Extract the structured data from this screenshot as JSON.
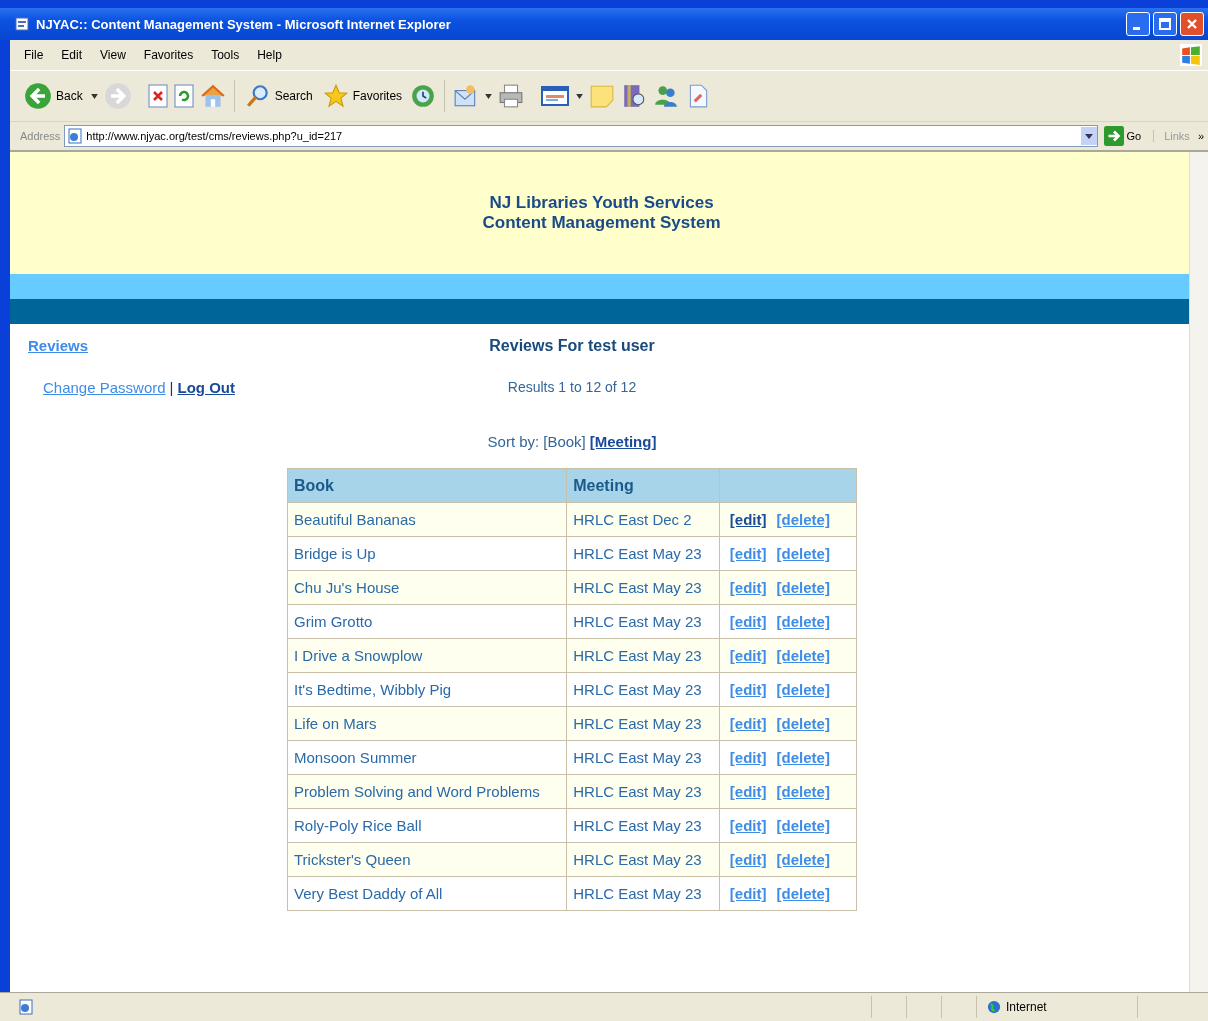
{
  "window": {
    "title": "NJYAC:: Content Management System - Microsoft Internet Explorer"
  },
  "menu": [
    "File",
    "Edit",
    "View",
    "Favorites",
    "Tools",
    "Help"
  ],
  "toolbar": {
    "back": "Back",
    "search": "Search",
    "favorites": "Favorites"
  },
  "address_bar": {
    "label": "Address",
    "url": "http://www.njyac.org/test/cms/reviews.php?u_id=217",
    "go": "Go",
    "links": "Links",
    "more": "»"
  },
  "banner": {
    "line_1": "NJ Libraries Youth Services",
    "line_2": "Content Management System"
  },
  "nav": {
    "reviews": {
      "label": "Reviews",
      "visited": false
    },
    "links": [
      {
        "label": "Change Password",
        "visited": false
      },
      {
        "label": "Log Out",
        "visited": true
      }
    ],
    "separator": "|"
  },
  "heading": "Reviews For test user",
  "results": "Results 1 to 12 of 12",
  "sort": {
    "label": "Sort by:",
    "options": [
      {
        "label": "[Book]",
        "selected": true
      },
      {
        "label": "[Meeting]",
        "selected": false
      }
    ]
  },
  "table": {
    "columns": [
      "Book",
      "Meeting"
    ],
    "rows": [
      {
        "book": "Beautiful Bananas",
        "meeting": "HRLC East Dec 2",
        "actions": [
          {
            "label": "[edit]",
            "visited": true
          },
          {
            "label": "[delete]",
            "visited": false
          }
        ]
      },
      {
        "book": "Bridge is Up",
        "meeting": "HRLC East May 23",
        "actions": [
          {
            "label": "[edit]",
            "visited": false
          },
          {
            "label": "[delete]",
            "visited": false
          }
        ]
      },
      {
        "book": "Chu Ju's House",
        "meeting": "HRLC East May 23",
        "actions": [
          {
            "label": "[edit]",
            "visited": false
          },
          {
            "label": "[delete]",
            "visited": false
          }
        ]
      },
      {
        "book": "Grim Grotto",
        "meeting": "HRLC East May 23",
        "actions": [
          {
            "label": "[edit]",
            "visited": false
          },
          {
            "label": "[delete]",
            "visited": false
          }
        ]
      },
      {
        "book": "I Drive a Snowplow",
        "meeting": "HRLC East May 23",
        "actions": [
          {
            "label": "[edit]",
            "visited": false
          },
          {
            "label": "[delete]",
            "visited": false
          }
        ]
      },
      {
        "book": "It's Bedtime, Wibbly Pig",
        "meeting": "HRLC East May 23",
        "actions": [
          {
            "label": "[edit]",
            "visited": false
          },
          {
            "label": "[delete]",
            "visited": false
          }
        ]
      },
      {
        "book": "Life on Mars",
        "meeting": "HRLC East May 23",
        "actions": [
          {
            "label": "[edit]",
            "visited": false
          },
          {
            "label": "[delete]",
            "visited": false
          }
        ]
      },
      {
        "book": "Monsoon Summer",
        "meeting": "HRLC East May 23",
        "actions": [
          {
            "label": "[edit]",
            "visited": false
          },
          {
            "label": "[delete]",
            "visited": false
          }
        ]
      },
      {
        "book": "Problem Solving and Word Problems",
        "meeting": "HRLC East May 23",
        "actions": [
          {
            "label": "[edit]",
            "visited": false
          },
          {
            "label": "[delete]",
            "visited": false
          }
        ]
      },
      {
        "book": "Roly-Poly Rice Ball",
        "meeting": "HRLC East May 23",
        "actions": [
          {
            "label": "[edit]",
            "visited": false
          },
          {
            "label": "[delete]",
            "visited": false
          }
        ]
      },
      {
        "book": "Trickster's Queen",
        "meeting": "HRLC East May 23",
        "actions": [
          {
            "label": "[edit]",
            "visited": false
          },
          {
            "label": "[delete]",
            "visited": false
          }
        ]
      },
      {
        "book": "Very Best Daddy of All",
        "meeting": "HRLC East May 23",
        "actions": [
          {
            "label": "[edit]",
            "visited": false
          },
          {
            "label": "[delete]",
            "visited": false
          }
        ]
      }
    ]
  },
  "status_bar": {
    "zone": "Internet"
  }
}
